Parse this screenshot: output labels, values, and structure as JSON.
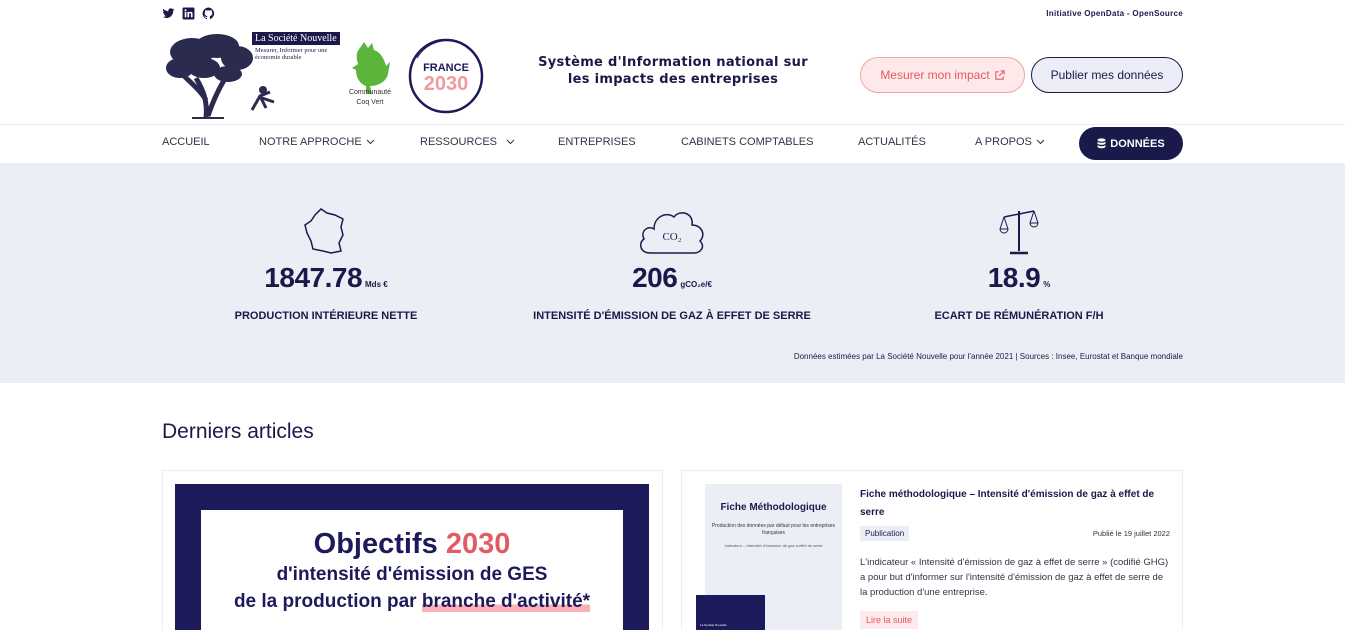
{
  "topbar": {
    "social": [
      "twitter-icon",
      "linkedin-icon",
      "github-icon"
    ],
    "right_text": "Initiative OpenData - OpenSource"
  },
  "header": {
    "brand_name": "La Société Nouvelle",
    "brand_tagline": "Mesurer, Informer pour une économie durable",
    "coq_label_line1": "Communauté",
    "coq_label_line2": "Coq Vert",
    "france_text": "FRANCE",
    "france_year": "2030",
    "tagline": "Système d'Information national sur les impacts des entreprises",
    "btn_impact": "Mesurer mon impact",
    "btn_publish": "Publier mes données"
  },
  "nav": {
    "items": [
      {
        "label": "ACCUEIL",
        "dropdown": false
      },
      {
        "label": "NOTRE APPROCHE",
        "dropdown": true
      },
      {
        "label": "RESSOURCES",
        "dropdown": true
      },
      {
        "label": "ENTREPRISES",
        "dropdown": false
      },
      {
        "label": "CABINETS COMPTABLES",
        "dropdown": false
      },
      {
        "label": "ACTUALITÉS",
        "dropdown": false
      },
      {
        "label": "A PROPOS",
        "dropdown": true
      }
    ],
    "data_button": "DONNÉES"
  },
  "stats": {
    "items": [
      {
        "icon": "france-map-icon",
        "value": "1847.78",
        "unit": "Mds €",
        "label": "PRODUCTION INTÉRIEURE NETTE"
      },
      {
        "icon": "co2-cloud-icon",
        "icon_text": "CO₂",
        "value": "206",
        "unit": "gCO₂e/€",
        "label": "INTENSITÉ D'ÉMISSION DE GAZ À EFFET DE SERRE"
      },
      {
        "icon": "balance-scale-icon",
        "value": "18.9",
        "unit": "%",
        "label": "ECART DE RÉMUNÉRATION F/H"
      }
    ],
    "source": "Données estimées par La Société Nouvelle pour l'année 2021 | Sources : Insee, Eurostat et Banque mondiale"
  },
  "articles": {
    "title": "Derniers articles",
    "featured": {
      "heading": "Objectifs",
      "heading_year": "2030",
      "line1": "d'intensité d'émission de GES",
      "line2_prefix": "de la production par ",
      "line2_highlight": "branche d'activité*"
    },
    "card": {
      "doc_title": "Fiche Méthodologique",
      "doc_sub": "Production des données par défaut pour les entreprises françaises",
      "doc_sub2": "Indicateur – Intensité d'émission de gaz à effet de serre",
      "doc_brand": "La Société Nouvelle",
      "title": "Fiche méthodologique – Intensité d'émission de gaz à effet de serre",
      "tag": "Publication",
      "date": "Publié le 19 juillet 2022",
      "excerpt": "L'indicateur « Intensité d'émission de gaz à effet de serre » (codifié GHG) a pour but d'informer sur l'intensité d'émission de gaz à effet de serre de la production d'une entreprise.",
      "more": "Lire la suite"
    }
  }
}
